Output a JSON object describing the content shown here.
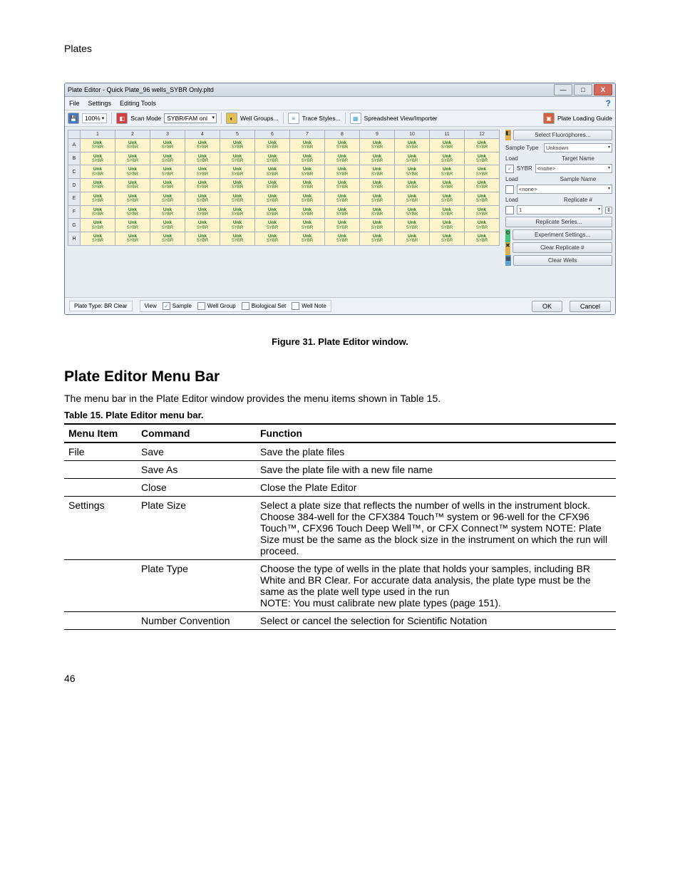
{
  "header": "Plates",
  "window": {
    "title": "Plate Editor - Quick Plate_96 wells_SYBR Only.pltd",
    "controls": {
      "min": "—",
      "max": "□",
      "close": "X"
    },
    "menubar": {
      "file": "File",
      "settings": "Settings",
      "tools": "Editing Tools",
      "help": "?"
    },
    "toolbar": {
      "zoom": "100%",
      "scan_mode": "Scan Mode",
      "scan_value": "SYBR/FAM onl",
      "well_groups": "Well Groups...",
      "trace_styles": "Trace Styles...",
      "spreadsheet": "Spreadsheet View/Importer",
      "loading_guide": "Plate Loading Guide"
    },
    "grid": {
      "cols": [
        "1",
        "2",
        "3",
        "4",
        "5",
        "6",
        "7",
        "8",
        "9",
        "10",
        "11",
        "12"
      ],
      "rows": [
        "A",
        "B",
        "C",
        "D",
        "E",
        "F",
        "G",
        "H"
      ],
      "cell_top": "Unk",
      "cell_bot": "SYBR"
    },
    "side": {
      "select_fluor": "Select Fluorophores...",
      "sample_type": "Sample Type",
      "sample_type_val": "Unknown",
      "load1": "Load",
      "target_name": "Target Name",
      "sybr": "SYBR",
      "none1": "<none>",
      "load2": "Load",
      "sample_name": "Sample Name",
      "none2": "<none>",
      "load3": "Load",
      "replicate_num": "Replicate #",
      "replicate_val": "1",
      "replicate_series": "Replicate Series...",
      "experiment_settings": "Experiment Settings...",
      "clear_replicate": "Clear Replicate #",
      "clear_wells": "Clear Wells"
    },
    "bottom": {
      "plate_type": "Plate Type: BR Clear",
      "view": "View",
      "sample": "Sample",
      "well_group": "Well Group",
      "bio_set": "Biological Set",
      "well_note": "Well Note",
      "ok": "OK",
      "cancel": "Cancel"
    }
  },
  "figure_caption": "Figure 31. Plate Editor window.",
  "section_heading": "Plate Editor Menu Bar",
  "intro_text": "The menu bar in the Plate Editor window provides the menu items shown in Table 15.",
  "table_caption": "Table 15. Plate Editor menu bar.",
  "table": {
    "headers": {
      "c1": "Menu Item",
      "c2": "Command",
      "c3": "Function"
    },
    "rows": [
      {
        "c1": "File",
        "c2": "Save",
        "c3": "Save the plate files"
      },
      {
        "c1": "",
        "c2": "Save As",
        "c3": "Save the plate file with a new file name"
      },
      {
        "c1": "",
        "c2": "Close",
        "c3": "Close the Plate Editor"
      },
      {
        "c1": "Settings",
        "c2": "Plate Size",
        "c3": "Select a plate size that reflects the number of wells in the instrument block. Choose 384-well for the CFX384 Touch™ system or 96-well for the CFX96 Touch™, CFX96 Touch Deep Well™, or CFX Connect™ system NOTE: Plate Size must be the same as the block size in the instrument on which the run will proceed."
      },
      {
        "c1": "",
        "c2": "Plate Type",
        "c3": "Choose the type of wells in the plate that holds your samples, including BR White and BR Clear. For accurate data analysis, the plate type must be the same as the plate well type used in the run\nNOTE: You must calibrate new plate types (page 151)."
      },
      {
        "c1": "",
        "c2": "Number Convention",
        "c3": "Select or cancel the selection for Scientific Notation"
      }
    ]
  },
  "page_number": "46"
}
